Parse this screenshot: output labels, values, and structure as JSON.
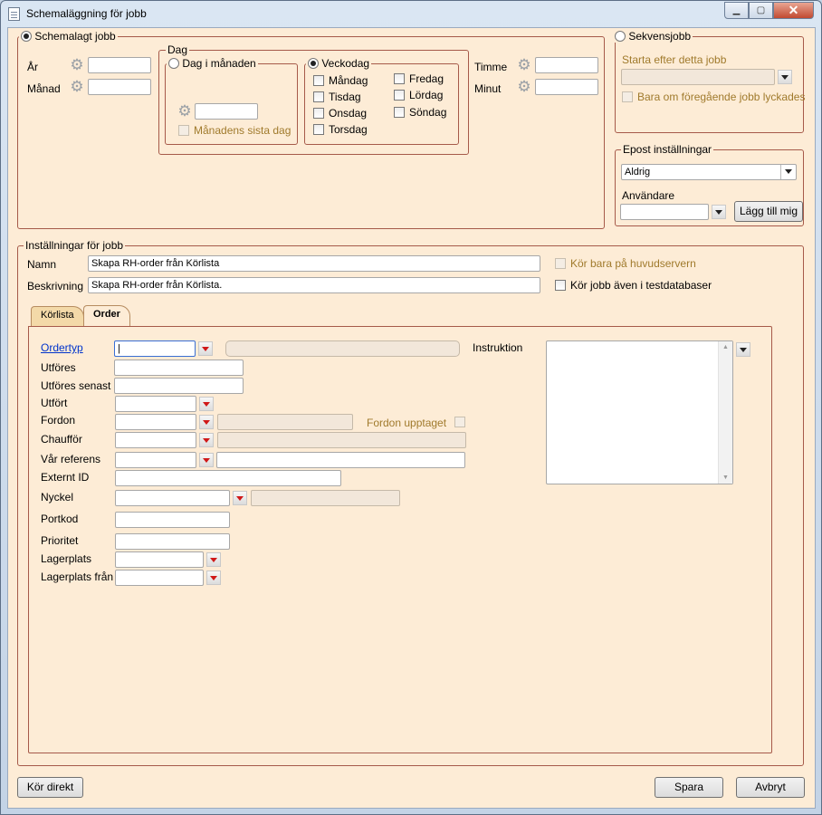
{
  "window": {
    "title": "Schemaläggning för jobb"
  },
  "schedule": {
    "group_label": "Schemalagt jobb",
    "year_label": "År",
    "month_label": "Månad",
    "hour_label": "Timme",
    "minute_label": "Minut",
    "day_group_label": "Dag",
    "day_of_month_label": "Dag i månaden",
    "last_day_label": "Månadens sista dag",
    "weekday_label": "Veckodag",
    "weekdays": [
      "Måndag",
      "Tisdag",
      "Onsdag",
      "Torsdag",
      "Fredag",
      "Lördag",
      "Söndag"
    ]
  },
  "sequence": {
    "group_label": "Sekvensjobb",
    "start_after_label": "Starta efter detta jobb",
    "only_if_success_label": "Bara om föregående jobb lyckades"
  },
  "email": {
    "group_label": "Epost inställningar",
    "frequency_value": "Aldrig",
    "users_label": "Användare",
    "add_me_label": "Lägg till mig"
  },
  "job_settings": {
    "group_label": "Inställningar för jobb",
    "name_label": "Namn",
    "name_value": "Skapa RH-order från Körlista",
    "description_label": "Beskrivning",
    "description_value": "Skapa RH-order från Körlista.",
    "main_server_only_label": "Kör bara på huvudservern",
    "run_in_test_db_label": "Kör jobb även i testdatabaser"
  },
  "tabs": [
    "Körlista",
    "Order"
  ],
  "order": {
    "order_type_label": "Ordertyp",
    "execute_label": "Utföres",
    "execute_latest_label": "Utföres senast",
    "executed_label": "Utfört",
    "vehicle_label": "Fordon",
    "vehicle_taken_label": "Fordon upptaget",
    "driver_label": "Chaufför",
    "our_reference_label": "Vår referens",
    "external_id_label": "Externt ID",
    "key_label": "Nyckel",
    "door_code_label": "Portkod",
    "priority_label": "Prioritet",
    "storage_label": "Lagerplats",
    "storage_from_label": "Lagerplats från",
    "instruction_label": "Instruktion"
  },
  "footer": {
    "run_now_label": "Kör direkt",
    "save_label": "Spara",
    "cancel_label": "Avbryt"
  }
}
